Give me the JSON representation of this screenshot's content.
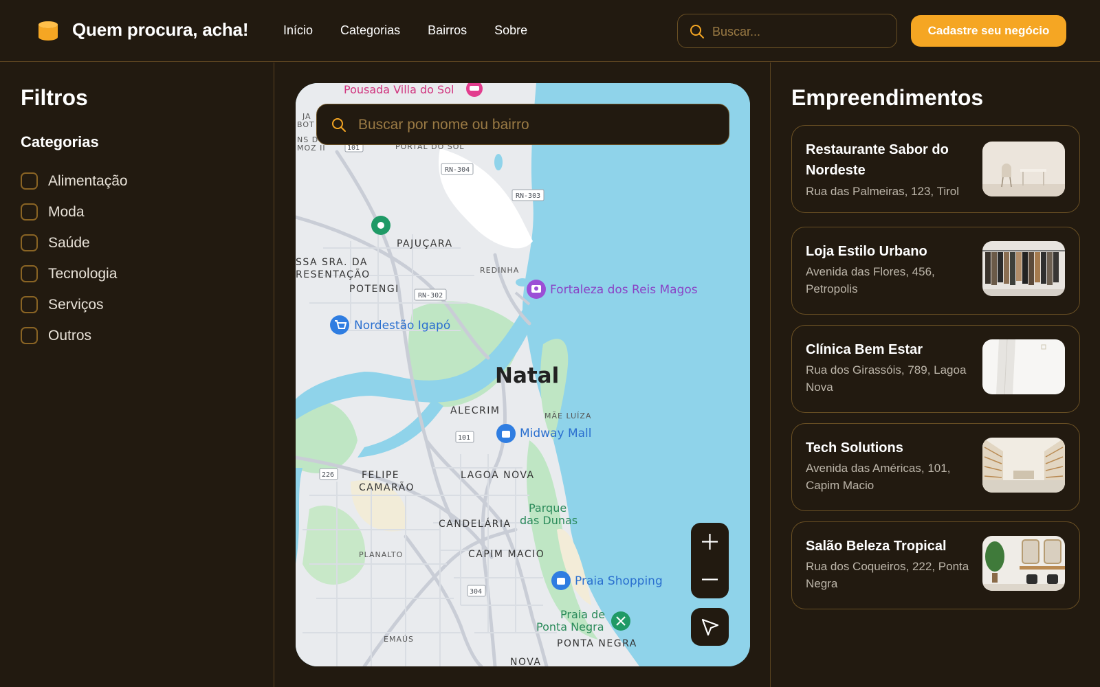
{
  "header": {
    "brand": "Quem procura, acha!",
    "nav": [
      "Início",
      "Categorias",
      "Bairros",
      "Sobre"
    ],
    "search_placeholder": "Buscar...",
    "cta_label": "Cadastre seu negócio"
  },
  "sidebar": {
    "title": "Filtros",
    "section_title": "Categorias",
    "categories": [
      "Alimentação",
      "Moda",
      "Saúde",
      "Tecnologia",
      "Serviços",
      "Outros"
    ]
  },
  "map": {
    "search_placeholder": "Buscar por nome ou bairro",
    "city_label": "Natal",
    "labels": {
      "pousada": "Pousada Villa do Sol",
      "fortaleza": "Fortaleza dos Reis Magos",
      "nordestao": "Nordestão Igapó",
      "midway": "Midway Mall",
      "praia_shopping": "Praia Shopping",
      "praia_ponta_negra_1": "Praia de",
      "praia_ponta_negra_2": "Ponta Negra",
      "parque_1": "Parque",
      "parque_2": "das Dunas",
      "pajucara": "PAJUÇARA",
      "redinha": "REDINHA",
      "potengi": "POTENGI",
      "apresentacao_1": "SSA SRA. DA",
      "apresentacao_2": "RESENTAÇÃO",
      "alecrim": "ALECRIM",
      "mae_luiza": "MÃE LUÍZA",
      "lagoa_nova": "LAGOA NOVA",
      "felipe_1": "FELIPE",
      "felipe_2": "CAMARÃO",
      "candelaria": "CANDELÁRIA",
      "capim_macio": "CAPIM MACIO",
      "planalto": "PLANALTO",
      "emaus": "EMAÚS",
      "ponta_negra": "PONTA NEGRA",
      "nova": "NOVA",
      "portal_do_sol": "PORTAL DO SOL",
      "ja": "JA",
      "bot": "BOT",
      "ns_d": "NS D",
      "moz": "MOZ II"
    },
    "road_shields": [
      "RN-304",
      "RN-303",
      "RN-302",
      "101",
      "101",
      "226",
      "304"
    ]
  },
  "listings": {
    "title": "Empreendimentos",
    "items": [
      {
        "name": "Restaurante Sabor do Nordeste",
        "address": "Rua das Palmeiras, 123, Tirol"
      },
      {
        "name": "Loja Estilo Urbano",
        "address": "Avenida das Flores, 456, Petropolis"
      },
      {
        "name": "Clínica Bem Estar",
        "address": "Rua dos Girassóis, 789, Lagoa Nova"
      },
      {
        "name": "Tech Solutions",
        "address": "Avenida das Américas, 101, Capim Macio"
      },
      {
        "name": "Salão Beleza Tropical",
        "address": "Rua dos Coqueiros, 222, Ponta Negra"
      }
    ]
  },
  "colors": {
    "background": "#221a10",
    "accent": "#f5a623",
    "border": "#5a4320",
    "map_water": "#8fd3ea"
  },
  "icons": [
    "database-logo-icon",
    "search-icon",
    "plus-icon",
    "minus-icon",
    "navigation-arrow-icon"
  ]
}
